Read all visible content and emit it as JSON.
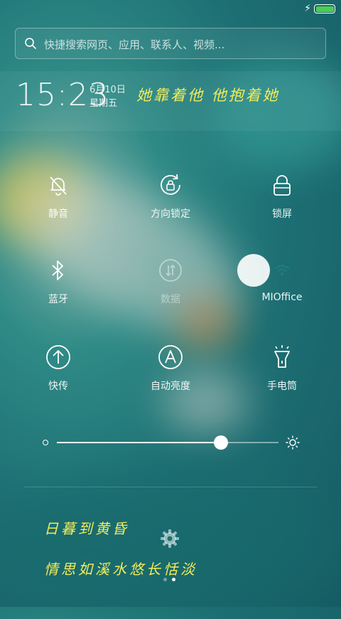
{
  "status": {
    "battery_level": 1.0,
    "battery_color": "#49d04f",
    "charging_icon": "lightning-bolt-icon"
  },
  "search": {
    "placeholder": "快捷搜索网页、应用、联系人、视频..."
  },
  "header": {
    "time": "15:23",
    "date": "6月10日",
    "weekday": "星期五",
    "phrase": "她靠着他 他抱着她"
  },
  "toggles": [
    {
      "label": "静音",
      "icon": "bell-off-icon",
      "active": false,
      "dim": false
    },
    {
      "label": "方向锁定",
      "icon": "rotation-lock-icon",
      "active": false,
      "dim": false
    },
    {
      "label": "锁屏",
      "icon": "lock-icon",
      "active": false,
      "dim": false
    },
    {
      "label": "蓝牙",
      "icon": "bluetooth-icon",
      "active": false,
      "dim": false
    },
    {
      "label": "数据",
      "icon": "mobile-data-icon",
      "active": false,
      "dim": true
    },
    {
      "label": "MIOffice",
      "icon": "wifi-icon",
      "active": true,
      "dim": false
    },
    {
      "label": "快传",
      "icon": "upload-arrow-icon",
      "active": false,
      "dim": false
    },
    {
      "label": "自动亮度",
      "icon": "auto-brightness-icon",
      "active": false,
      "dim": false
    },
    {
      "label": "手电筒",
      "icon": "flashlight-icon",
      "active": false,
      "dim": false
    }
  ],
  "brightness": {
    "level": 0.74
  },
  "poem": {
    "line1": "日暮到黄昏",
    "line2": "情思如溪水悠长恬淡"
  },
  "pager": {
    "count": 2,
    "current": 2
  },
  "colors": {
    "accent_text": "#f3ec5b",
    "wifi_icon": "#1d7c7a"
  }
}
